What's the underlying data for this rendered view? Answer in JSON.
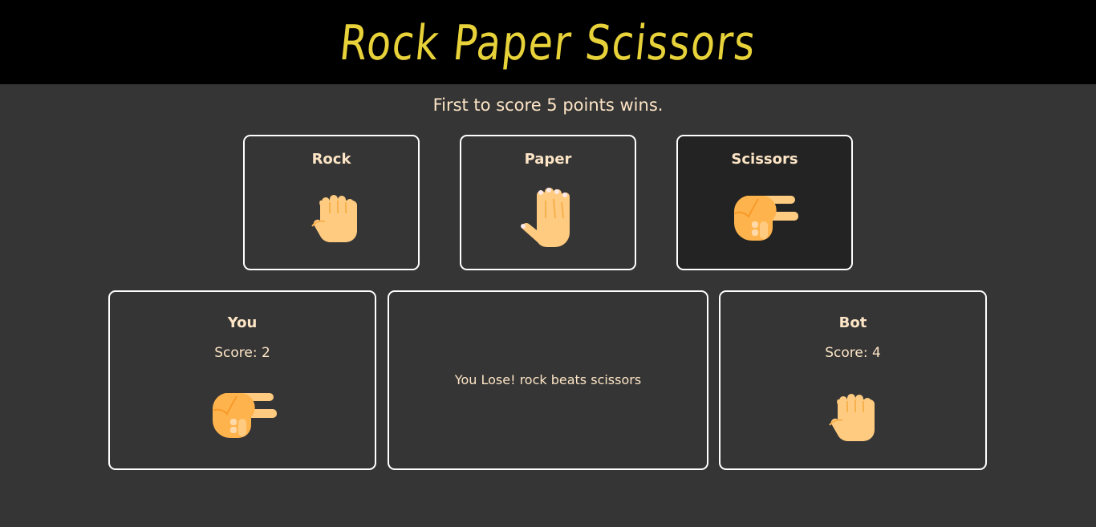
{
  "header": {
    "title": "Rock Paper Scissors"
  },
  "subtitle": "First to score 5 points wins.",
  "choices": [
    {
      "label": "Rock",
      "icon": "rock-hand-icon",
      "selected": false
    },
    {
      "label": "Paper",
      "icon": "paper-hand-icon",
      "selected": false
    },
    {
      "label": "Scissors",
      "icon": "scissors-hand-icon",
      "selected": true
    }
  ],
  "player": {
    "name": "You",
    "score_text": "Score: 2",
    "hand_icon": "scissors-hand-icon"
  },
  "result": {
    "message": "You Lose! rock beats scissors"
  },
  "bot": {
    "name": "Bot",
    "score_text": "Score: 4",
    "hand_icon": "rock-hand-icon"
  },
  "colors": {
    "background": "#353535",
    "header_background": "#000000",
    "title": "#e8d23a",
    "text": "#fde5c6",
    "selected_card": "#232323",
    "skin": "#ffcb80",
    "skin_shadow": "#f7b14e"
  }
}
